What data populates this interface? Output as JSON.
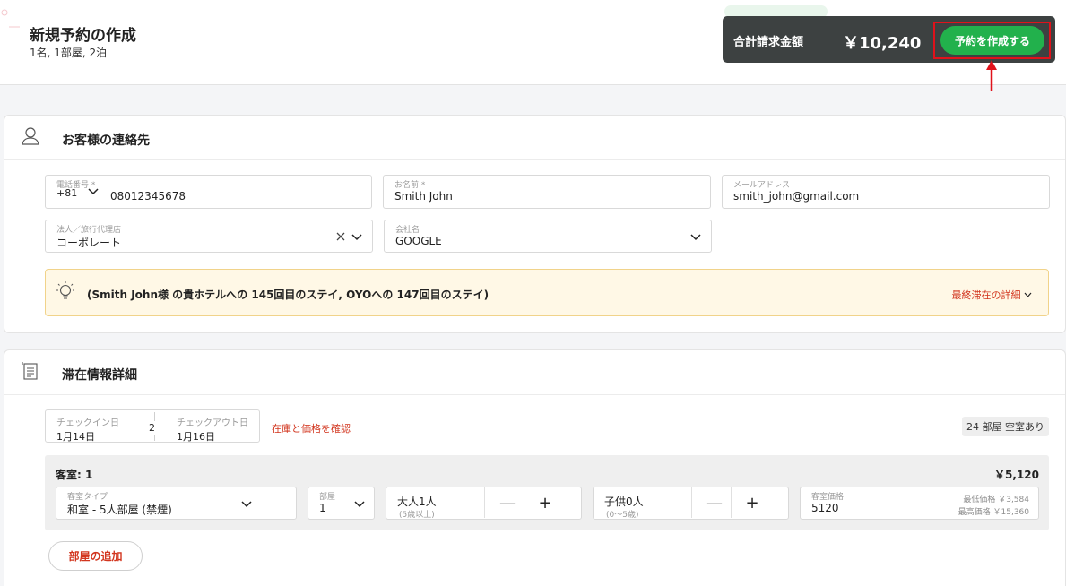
{
  "header": {
    "title": "新規予約の作成",
    "subtitle": "1名, 1部屋, 2泊",
    "total_label": "合計請求金額",
    "total_amount": "￥10,240",
    "create_button": "予約を作成する"
  },
  "contact": {
    "section_title": "お客様の連絡先",
    "phone": {
      "label": "電話番号 *",
      "country_code": "+81",
      "value": "08012345678"
    },
    "name": {
      "label": "お名前 *",
      "value": "Smith John"
    },
    "email": {
      "label": "メールアドレス",
      "value": "smith_john@gmail.com"
    },
    "corporate": {
      "label": "法人／旅行代理店",
      "value": "コーポレート"
    },
    "company": {
      "label": "会社名",
      "value": "GOOGLE"
    },
    "tip_text": "(Smith John様 の貴ホテルへの 145回目のステイ, OYOへの 147回目のステイ)",
    "tip_link": "最終滞在の詳細"
  },
  "stay": {
    "section_title": "滞在情報詳細",
    "checkin_label": "チェックイン日",
    "checkin_value": "1月14日",
    "nights": "2",
    "checkout_label": "チェックアウト日",
    "checkout_value": "1月16日",
    "check_link": "在庫と価格を確認",
    "availability": "24 部屋 空室あり",
    "room_heading": "客室: 1",
    "room_price": "￥5,120",
    "room_type_label": "客室タイプ",
    "room_type_value": "和室 - 5人部屋 (禁煙)",
    "rooms_label": "部屋",
    "rooms_value": "1",
    "adults_value": "大人1人",
    "adults_note": "(5歳以上)",
    "children_value": "子供0人",
    "children_note": "(0〜5歳)",
    "rate_label": "客室価格",
    "rate_value": "5120",
    "min_price": "最低価格 ￥3,584",
    "max_price": "最高価格 ￥15,360",
    "add_room": "部屋の追加"
  },
  "colors": {
    "accent_green": "#22b14c",
    "link_red": "#d2351e",
    "annotation_red": "#e0121b",
    "total_bar": "#3d4141"
  }
}
